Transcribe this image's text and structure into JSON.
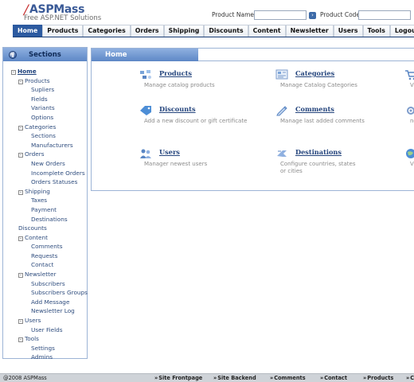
{
  "brand": {
    "slash": "/",
    "name": "ASPMass",
    "tagline": "Free ASP.NET Solutions"
  },
  "search": {
    "product_name_label": "Product Name:",
    "product_name_value": "",
    "product_code_label": "Product Code:",
    "product_code_value": "",
    "go_icon": "arrow-right-icon"
  },
  "topnav": [
    "Home",
    "Products",
    "Categories",
    "Orders",
    "Shipping",
    "Discounts",
    "Content",
    "Newsletter",
    "Users",
    "Tools",
    "Logout"
  ],
  "sidebar": {
    "title": "Sections",
    "tree": [
      {
        "label": "Home",
        "level": "root",
        "toggle": "⊟",
        "style": "bold"
      },
      {
        "label": "Products",
        "level": 1,
        "toggle": "⊟"
      },
      {
        "label": "Supliers",
        "level": 2
      },
      {
        "label": "Fields",
        "level": 2
      },
      {
        "label": "Variants",
        "level": 2
      },
      {
        "label": "Options",
        "level": 2
      },
      {
        "label": "Categories",
        "level": 1,
        "toggle": "⊟"
      },
      {
        "label": "Sections",
        "level": 2
      },
      {
        "label": "Manufacturers",
        "level": 2
      },
      {
        "label": "Orders",
        "level": 1,
        "toggle": "⊟"
      },
      {
        "label": "New Orders",
        "level": 2
      },
      {
        "label": "Incomplete Orders",
        "level": 2
      },
      {
        "label": "Orders Statuses",
        "level": 2
      },
      {
        "label": "Shipping",
        "level": 1,
        "toggle": "⊟"
      },
      {
        "label": "Taxes",
        "level": 2
      },
      {
        "label": "Payment",
        "level": 2
      },
      {
        "label": "Destinations",
        "level": 2
      },
      {
        "label": "Discounts",
        "level": 1
      },
      {
        "label": "Content",
        "level": 1,
        "toggle": "⊟"
      },
      {
        "label": "Comments",
        "level": 2
      },
      {
        "label": "Requests",
        "level": 2
      },
      {
        "label": "Contact",
        "level": 2
      },
      {
        "label": "Newsletter",
        "level": 1,
        "toggle": "⊟"
      },
      {
        "label": "Subscribers",
        "level": 2
      },
      {
        "label": "Subscribers Groups",
        "level": 2
      },
      {
        "label": "Add Message",
        "level": 2
      },
      {
        "label": "Newsletter Log",
        "level": 2
      },
      {
        "label": "Users",
        "level": 1,
        "toggle": "⊟"
      },
      {
        "label": "User Fields",
        "level": 2
      },
      {
        "label": "Tools",
        "level": 1,
        "toggle": "⊟"
      },
      {
        "label": "Settings",
        "level": 2
      },
      {
        "label": "Admins",
        "level": 2
      }
    ]
  },
  "main": {
    "title": "Home",
    "cards": [
      {
        "title": "Products",
        "desc": "Manage catalog products",
        "icon": "products-icon"
      },
      {
        "title": "Categories",
        "desc": "Manage Catalog Categories",
        "icon": "categories-icon"
      },
      {
        "title": "",
        "desc": "Vi",
        "icon": "cart-icon"
      },
      {
        "title": "Discounts",
        "desc": "Add a new discount or gift certificate",
        "icon": "discount-tag-icon"
      },
      {
        "title": "Comments",
        "desc": "Manage last added comments",
        "icon": "comments-icon"
      },
      {
        "title": "",
        "desc": "ne",
        "icon": "gear-icon"
      },
      {
        "title": "Users",
        "desc": "Manager newest users",
        "icon": "users-icon"
      },
      {
        "title": "Destinations",
        "desc": "Configure countries, states or cities",
        "icon": "destinations-icon"
      },
      {
        "title": "",
        "desc": "Vi",
        "icon": "globe-icon"
      }
    ]
  },
  "footer": {
    "copyright": "@2008 ASPMass",
    "links": [
      "Site Frontpage",
      "Site Backend",
      "Comments",
      "Contact",
      "Products",
      "Ca"
    ]
  },
  "colors": {
    "accent": "#2c5aa0",
    "header_gradient_top": "#8fb0e0",
    "header_gradient_bottom": "#5d87c6",
    "link": "#25457d",
    "brand_red": "#c62b2b"
  }
}
